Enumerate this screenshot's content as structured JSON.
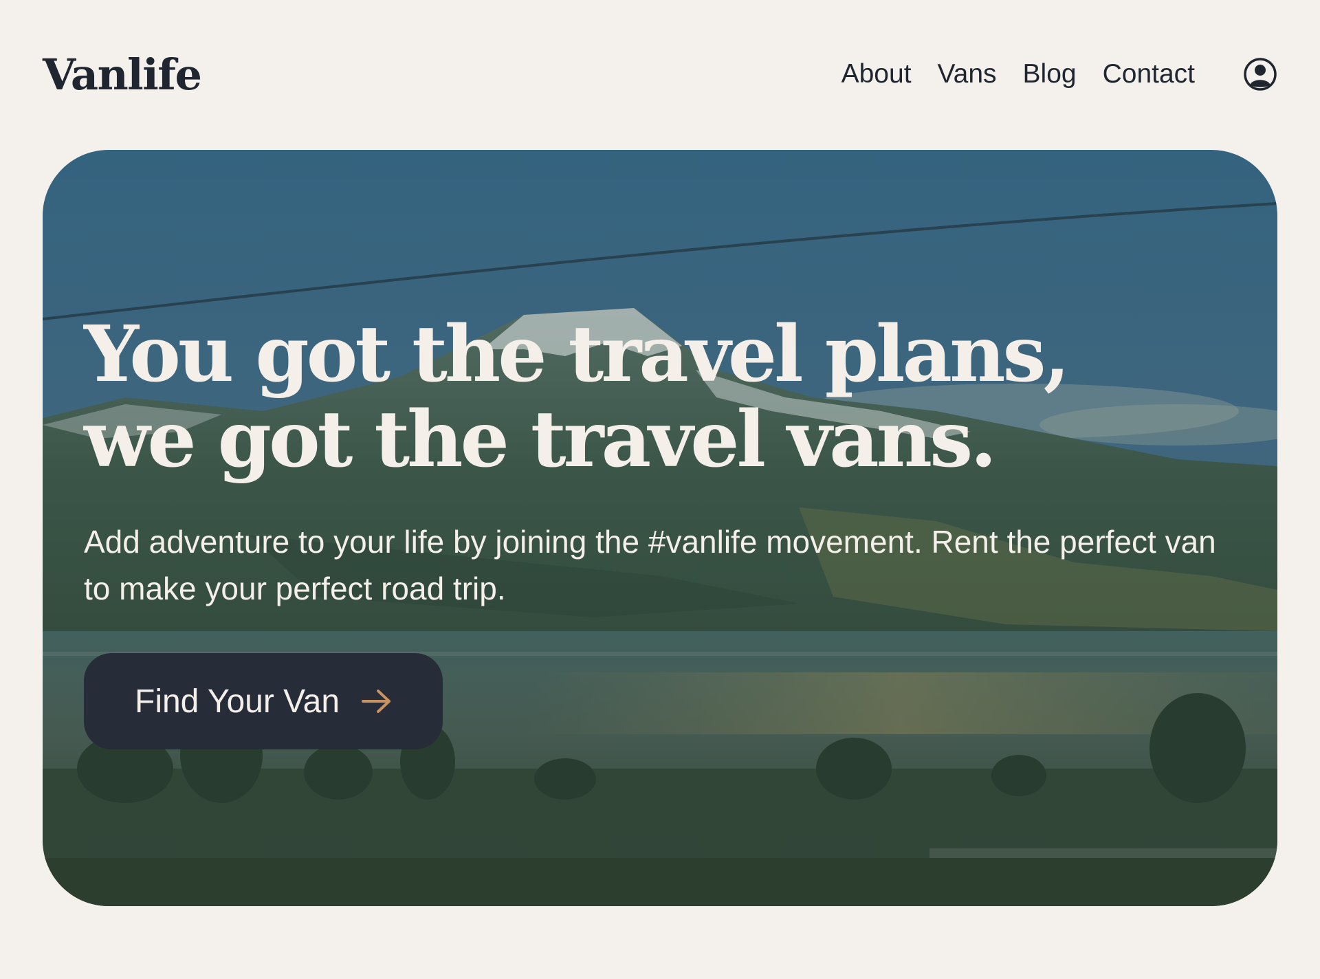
{
  "header": {
    "logo": "Vanlife",
    "nav": {
      "about": "About",
      "vans": "Vans",
      "blog": "Blog",
      "contact": "Contact"
    },
    "user_icon": "user-circle-icon"
  },
  "hero": {
    "title": "You got the travel plans, we got the travel vans.",
    "subtitle": "Add adventure to your life by joining the #vanlife movement. Rent the perfect van to make your perfect road trip.",
    "cta_label": "Find Your Van",
    "cta_icon": "arrow-right-icon",
    "background": "mountain-lake-photo"
  },
  "colors": {
    "page_background": "#f4f1ec",
    "text_dark": "#1f2630",
    "hero_text": "#f4efe8",
    "button_background": "#262c38",
    "arrow_accent": "#c9925e"
  }
}
